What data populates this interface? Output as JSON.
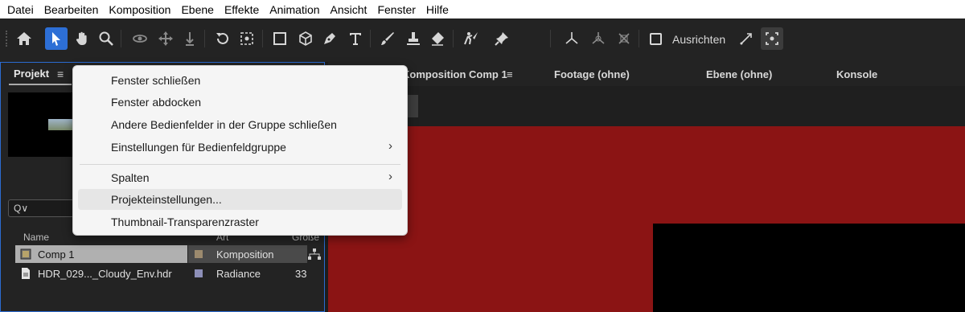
{
  "menubar": {
    "items": [
      "Datei",
      "Bearbeiten",
      "Komposition",
      "Ebene",
      "Effekte",
      "Animation",
      "Ansicht",
      "Fenster",
      "Hilfe"
    ]
  },
  "toolbar": {
    "snap_label": "Ausrichten",
    "tools": [
      "home-icon",
      "selection-tool-icon",
      "hand-tool-icon",
      "zoom-tool-icon",
      "orbit-camera-icon",
      "pan-camera-icon",
      "dolly-camera-icon",
      "rotate-tool-icon",
      "pan-behind-icon",
      "rectangle-tool-icon",
      "3d-box-icon",
      "pen-tool-icon",
      "text-tool-icon",
      "brush-tool-icon",
      "clone-stamp-icon",
      "eraser-tool-icon",
      "roto-brush-icon",
      "puppet-pin-icon",
      "local-axis-icon",
      "world-axis-icon",
      "view-axis-icon",
      "snap-icon",
      "snap-toggle-icon"
    ]
  },
  "project_panel": {
    "tab_label": "Projekt",
    "search_placeholder": "Q∨",
    "columns": {
      "name": "Name",
      "type": "Art",
      "size": "Größe"
    },
    "rows": [
      {
        "name": "Comp 1",
        "type": "Komposition",
        "size": "",
        "swatch": "#9c8a6e",
        "selected": true
      },
      {
        "name": "HDR_029..._Cloudy_Env.hdr",
        "type": "Radiance",
        "size": "33",
        "swatch": "#8d8fb8",
        "selected": false
      }
    ]
  },
  "right_tabs": {
    "composition": "Komposition Comp 1",
    "footage": "Footage (ohne)",
    "layer": "Ebene (ohne)",
    "console": "Konsole"
  },
  "context_menu": {
    "items": [
      {
        "label": "Fenster schließen",
        "submenu": false
      },
      {
        "label": "Fenster abdocken",
        "submenu": false
      },
      {
        "label": "Andere Bedienfelder in der Gruppe schließen",
        "submenu": false
      },
      {
        "label": "Einstellungen für Bedienfeldgruppe",
        "submenu": true
      },
      {
        "label": "Spalten",
        "submenu": true
      },
      {
        "label": "Projekteinstellungen...",
        "submenu": false,
        "hovered": true
      },
      {
        "label": "Thumbnail-Transparenzraster",
        "submenu": false
      }
    ],
    "submenu_arrow": "›"
  },
  "colors": {
    "accent": "#2d6fd6",
    "composition_bg": "#8b1414"
  }
}
